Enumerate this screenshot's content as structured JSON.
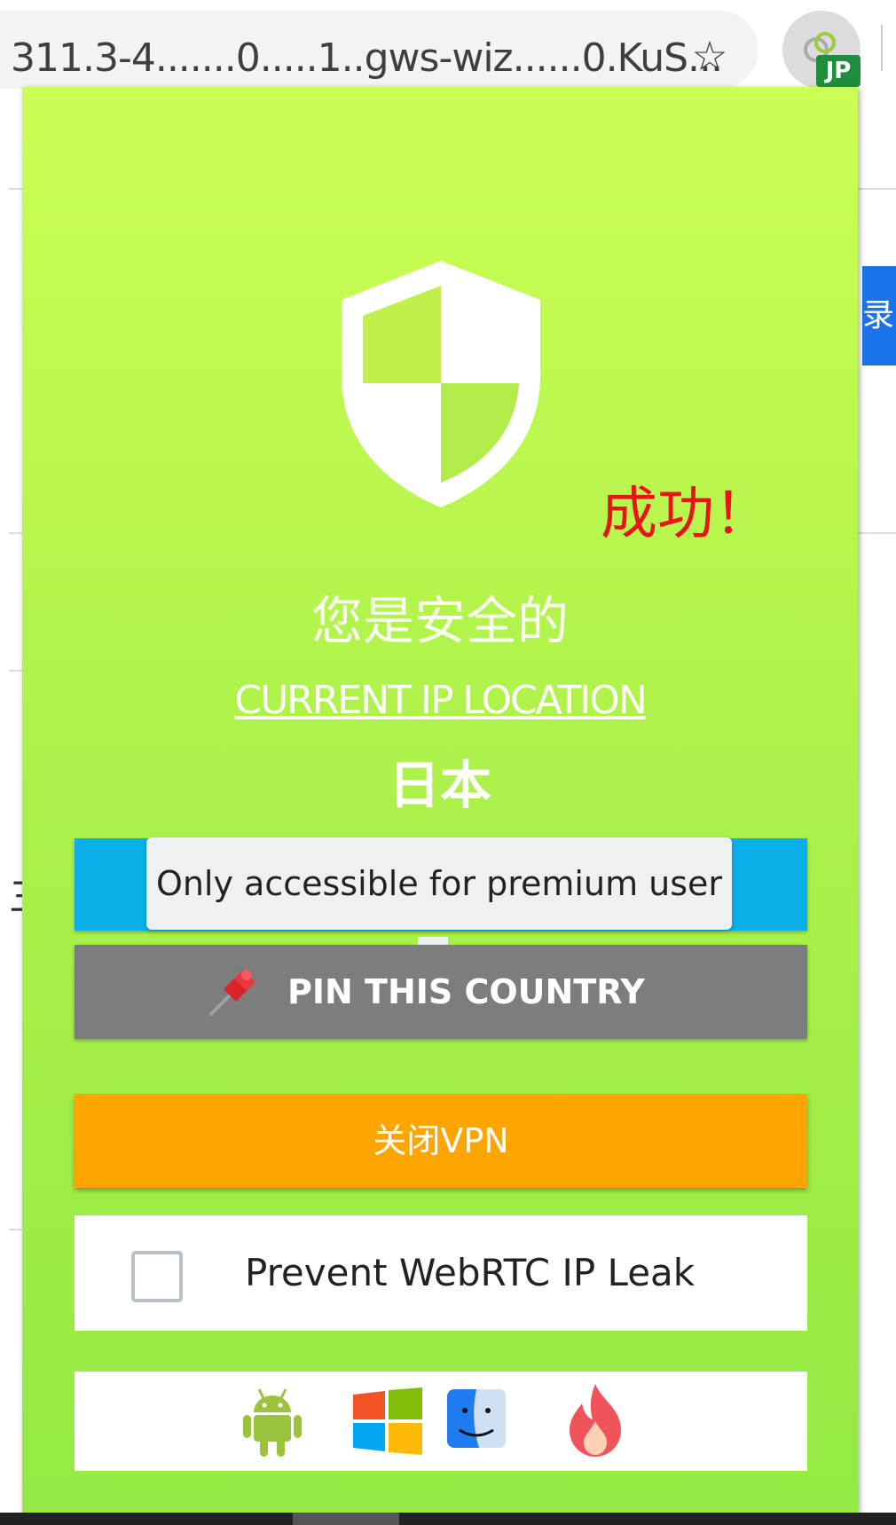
{
  "browser": {
    "url_text": "311.3-4.......0.....1..gws-wiz......0.KuS...",
    "bookmark_icon": "star-icon",
    "extension_badge": "JP",
    "side_button_char": "录",
    "side_text_char": "三"
  },
  "popup": {
    "status_icon": "shield-icon",
    "annotation": "成功！",
    "safe_title": "您是安全的",
    "ip_location_label": "CURRENT IP LOCATION",
    "country": "日本",
    "tooltip": "Only accessible for premium user",
    "pin_button_label": "PIN THIS COUNTRY",
    "pin_icon": "pushpin-icon",
    "vpn_button_label": "关闭VPN",
    "webrtc_label": "Prevent WebRTC IP Leak",
    "webrtc_checked": false,
    "platforms": [
      "android-icon",
      "windows-icon",
      "finder-icon",
      "flame-icon"
    ]
  },
  "colors": {
    "popup_top": "#ccff55",
    "popup_bottom": "#94e944",
    "accent_blue": "#0aafea",
    "pin_gray": "#7d7d7d",
    "vpn_orange": "#ffa500",
    "annotation_red": "#e8141a",
    "badge_green": "#1e8e3e"
  }
}
